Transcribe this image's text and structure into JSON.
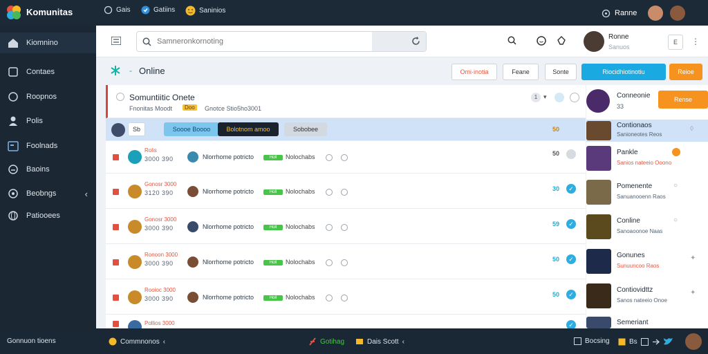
{
  "app": {
    "name": "Komunitas"
  },
  "top_nav": [
    {
      "label": "Gais",
      "icon": "chat-icon"
    },
    {
      "label": "Gatiins",
      "icon": "verified-icon"
    },
    {
      "label": "Saninios",
      "icon": "emoji-icon"
    }
  ],
  "top_user": {
    "name": "Ranne"
  },
  "sidebar": {
    "items": [
      {
        "label": "Kiomnino",
        "icon": "home-icon"
      },
      {
        "label": "Contaes",
        "icon": "contacts-icon"
      },
      {
        "label": "Roopnos",
        "icon": "chat-icon"
      },
      {
        "label": "Polis",
        "icon": "user-icon"
      },
      {
        "label": "Foolnads",
        "icon": "calendar-icon"
      },
      {
        "label": "Baoins",
        "icon": "notification-icon"
      },
      {
        "label": "Beobngs",
        "icon": "settings-icon"
      },
      {
        "label": "Patiooees",
        "icon": "globe-icon"
      }
    ]
  },
  "search": {
    "placeholder": "Samneronkornoting"
  },
  "profile": {
    "name": "Ronne",
    "subtitle": "Sanuos",
    "button": "E"
  },
  "toolbar": {
    "title": "Online",
    "buttons": [
      "Omi·inotia",
      "Feane",
      "Sonte",
      "Riocidhiotinotiu",
      "Reioe"
    ]
  },
  "header_row": {
    "title": "Somuntiitic Onete",
    "subtitle_a": "Fnonitas Moodt",
    "subtitle_tag": "Doo",
    "subtitle_b": "Gnotce Stio5ho3001",
    "count": "1"
  },
  "filter_row": {
    "chip1": "Sb",
    "chip2": "Soooe Boooo",
    "chip3": "Bolotnom amoo",
    "chip4": "Sobobee",
    "count": "50"
  },
  "rows": [
    {
      "label": "Rolis",
      "num": "3000 390",
      "name": "Nlorrhome potricto",
      "tag": "Holl",
      "status": "Nolochabs",
      "count": "50"
    },
    {
      "label": "Gonosr 3000",
      "num": "3120 390",
      "name": "Nlorrhome potricto",
      "tag": "Holl",
      "status": "Nolochabs",
      "count": "30"
    },
    {
      "label": "Gonosr 3000",
      "num": "3000 390",
      "name": "Nlorrhome potricto",
      "tag": "Holl",
      "status": "Nolochabs",
      "count": "59"
    },
    {
      "label": "Ronoon 3000",
      "num": "3000 390",
      "name": "Nlorrhome potricto",
      "tag": "Holl",
      "status": "Nolochabs",
      "count": "50"
    },
    {
      "label": "Rooioc 3000",
      "num": "3000 390",
      "name": "Nlorrhome potricto",
      "tag": "Holl",
      "status": "Nolochabs",
      "count": "50"
    },
    {
      "label": "Pollios 3000",
      "num": "",
      "name": "",
      "tag": "",
      "status": "",
      "count": ""
    }
  ],
  "panel": {
    "header": {
      "title": "Conneonie",
      "badge": "Rense",
      "count": "33"
    },
    "items": [
      {
        "title": "Contionaos",
        "sub": "Sanioneotes Reos"
      },
      {
        "title": "Pankle",
        "sub": "Sanios nateeio Ooono"
      },
      {
        "title": "Pomenente",
        "sub": "Sanuanooenn Raos"
      },
      {
        "title": "Conline",
        "sub": "Sanoaoonoe Naas"
      },
      {
        "title": "Gonunes",
        "sub": "Sunuuncoo Raos"
      },
      {
        "title": "Contiovidttz",
        "sub": "Sanos nateeio Onoe"
      },
      {
        "title": "Semeriant",
        "sub": ""
      }
    ]
  },
  "bottombar": {
    "left": "Gonnuon tioens",
    "mid1": "Commnonos",
    "mid2": "Gotihag",
    "mid3": "Dais Scott",
    "right1": "Bocsing",
    "right2": "Bs"
  },
  "colors": {
    "accent": "#1aa9e0",
    "orange": "#f6931f",
    "danger": "#e3503f",
    "green": "#47c548"
  }
}
